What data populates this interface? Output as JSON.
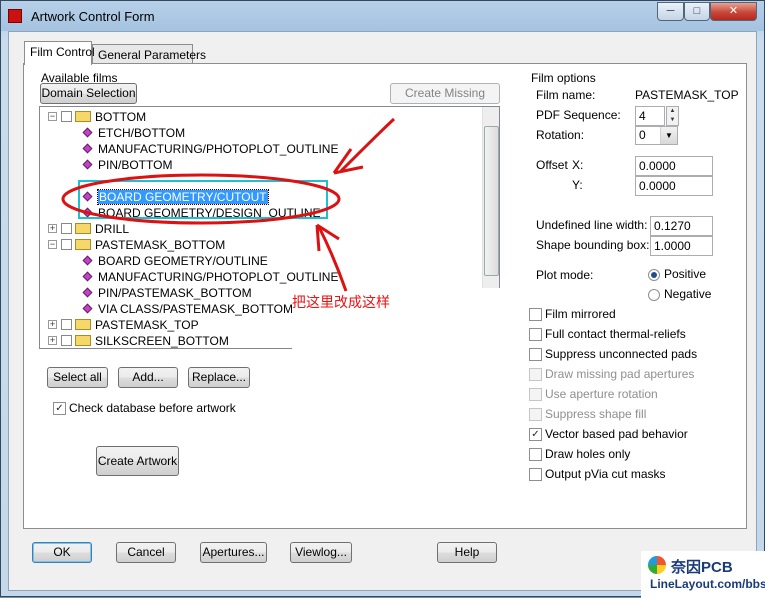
{
  "window": {
    "title": "Artwork Control Form",
    "min": "─",
    "max": "□",
    "close": "✕"
  },
  "tabs": [
    {
      "label": "Film Control"
    },
    {
      "label": "General Parameters"
    }
  ],
  "left": {
    "available_films_label": "Available films",
    "domain_selection": "Domain Selection",
    "create_missing_films": "Create Missing Films",
    "tree": [
      {
        "text": "BOTTOM",
        "kind": "film",
        "exp": "−"
      },
      {
        "text": "ETCH/BOTTOM",
        "kind": "layer"
      },
      {
        "text": "MANUFACTURING/PHOTOPLOT_OUTLINE",
        "kind": "layer"
      },
      {
        "text": "PIN/BOTTOM",
        "kind": "layer"
      },
      {
        "text": "BOARD GEOMETRY/CUTOUT",
        "kind": "layer",
        "selected": true
      },
      {
        "text": "BOARD GEOMETRY/DESIGN_OUTLINE",
        "kind": "layer"
      },
      {
        "text": "DRILL",
        "kind": "film",
        "exp": "+"
      },
      {
        "text": "PASTEMASK_BOTTOM",
        "kind": "film",
        "exp": "−",
        "open": true
      },
      {
        "text": "BOARD GEOMETRY/OUTLINE",
        "kind": "layer"
      },
      {
        "text": "MANUFACTURING/PHOTOPLOT_OUTLINE",
        "kind": "layer"
      },
      {
        "text": "PIN/PASTEMASK_BOTTOM",
        "kind": "layer"
      },
      {
        "text": "VIA CLASS/PASTEMASK_BOTTOM",
        "kind": "layer"
      },
      {
        "text": "PASTEMASK_TOP",
        "kind": "film",
        "exp": "+"
      },
      {
        "text": "SILKSCREEN_BOTTOM",
        "kind": "film",
        "exp": "+"
      }
    ],
    "select_all": "Select all",
    "add": "Add...",
    "replace": "Replace...",
    "check_database": "Check database before artwork",
    "create_artwork": "Create Artwork"
  },
  "film_options": {
    "group_label": "Film options",
    "film_name_label": "Film name:",
    "film_name_value": "PASTEMASK_TOP",
    "pdf_sequence_label": "PDF Sequence:",
    "pdf_sequence_value": "4",
    "rotation_label": "Rotation:",
    "rotation_value": "0",
    "offset_label": "Offset",
    "offset_x_label": "X:",
    "offset_x_value": "0.0000",
    "offset_y_label": "Y:",
    "offset_y_value": "0.0000",
    "undefined_line_width_label": "Undefined line width:",
    "undefined_line_width_value": "0.1270",
    "shape_bounding_box_label": "Shape bounding box:",
    "shape_bounding_box_value": "1.0000",
    "plot_mode_label": "Plot mode:",
    "positive": "Positive",
    "negative": "Negative",
    "checkboxes": [
      {
        "label": "Film mirrored",
        "checked": false,
        "enabled": true
      },
      {
        "label": "Full contact thermal-reliefs",
        "checked": false,
        "enabled": true
      },
      {
        "label": "Suppress unconnected pads",
        "checked": false,
        "enabled": true
      },
      {
        "label": "Draw missing pad apertures",
        "checked": false,
        "enabled": false
      },
      {
        "label": "Use aperture rotation",
        "checked": false,
        "enabled": false
      },
      {
        "label": "Suppress shape fill",
        "checked": false,
        "enabled": false
      },
      {
        "label": "Vector based pad behavior",
        "checked": true,
        "enabled": true
      },
      {
        "label": "Draw holes only",
        "checked": false,
        "enabled": true
      },
      {
        "label": "Output pVia cut masks",
        "checked": false,
        "enabled": true
      }
    ]
  },
  "footer": {
    "ok": "OK",
    "cancel": "Cancel",
    "apertures": "Apertures...",
    "viewlog": "Viewlog...",
    "help": "Help"
  },
  "annotation": {
    "text": "把这里改成这样",
    "color": "#ee1111",
    "box_color": "#1ec0d0"
  },
  "watermark": {
    "line1": "奈因PCB",
    "line2": "LineLayout.com/bbs"
  }
}
